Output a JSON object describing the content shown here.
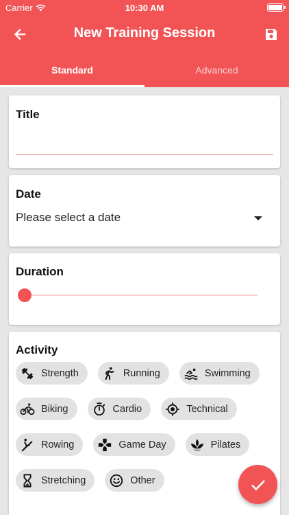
{
  "status_bar": {
    "carrier": "Carrier",
    "time": "10:30 AM"
  },
  "toolbar": {
    "title": "New Training Session",
    "back_icon": "arrow-left-icon",
    "save_icon": "save-icon"
  },
  "tabs": [
    {
      "label": "Standard",
      "active": true
    },
    {
      "label": "Advanced",
      "active": false
    }
  ],
  "title_field": {
    "label": "Title",
    "value": ""
  },
  "date_field": {
    "label": "Date",
    "value": "Please select a date"
  },
  "duration_field": {
    "label": "Duration",
    "value_fraction": 0.0
  },
  "activity": {
    "label": "Activity",
    "chips": [
      {
        "label": "Strength",
        "icon": "dumbbell-icon"
      },
      {
        "label": "Running",
        "icon": "running-icon"
      },
      {
        "label": "Swimming",
        "icon": "swimming-icon"
      },
      {
        "label": "Biking",
        "icon": "bike-icon"
      },
      {
        "label": "Cardio",
        "icon": "stopwatch-icon"
      },
      {
        "label": "Technical",
        "icon": "target-icon"
      },
      {
        "label": "Rowing",
        "icon": "rowing-icon"
      },
      {
        "label": "Game Day",
        "icon": "gamepad-icon"
      },
      {
        "label": "Pilates",
        "icon": "lotus-icon"
      },
      {
        "label": "Stretching",
        "icon": "hourglass-icon"
      },
      {
        "label": "Other",
        "icon": "smiley-icon"
      }
    ]
  },
  "fab": {
    "icon": "check-icon"
  },
  "colors": {
    "primary": "#f25456",
    "background": "#e6e6e6",
    "chip": "#e2e2e2"
  }
}
